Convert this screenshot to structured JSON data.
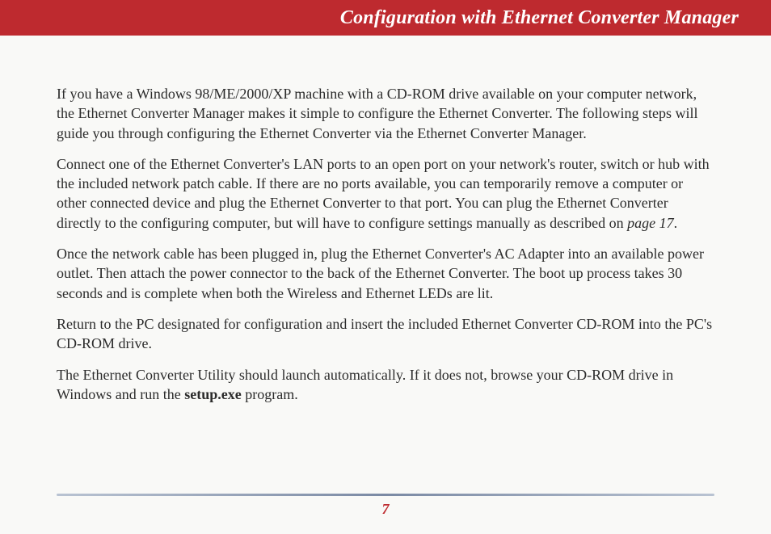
{
  "header": {
    "title": "Configuration with Ethernet Converter Manager"
  },
  "body": {
    "p1": "If you have a Windows 98/ME/2000/XP machine with a CD-ROM drive available on your computer network, the Ethernet Converter Manager makes it simple to configure the Ethernet Converter.  The following steps will guide you through configuring the Ethernet Converter via the Ethernet Converter Manager.",
    "p2_a": "Connect one of the Ethernet Converter's LAN ports to an open port on your network's router, switch or hub with the included network patch cable.  If there are no ports available, you can temporarily remove a computer or other connected device and plug the Ethernet Converter to that port.  You can plug the Ethernet Converter directly to the configuring computer, but will have to configure settings manually as described on ",
    "p2_ref": "page 17",
    "p2_b": ".",
    "p3": "Once the network cable has been plugged in, plug the Ethernet Converter's AC Adapter into an available power outlet.  Then attach the power connector to the back of the Ethernet Converter.  The boot up process takes 30 seconds and is complete when both the Wireless and Ethernet LEDs are lit.",
    "p4": "Return to the PC designated for configuration and insert the included Ethernet Converter CD-ROM into the PC's CD-ROM drive.",
    "p5_a": "The Ethernet Converter Utility should launch automatically.  If it does not, browse your CD-ROM drive in Windows and run the ",
    "p5_bold": "setup.exe",
    "p5_b": " program."
  },
  "footer": {
    "page_number": "7"
  }
}
